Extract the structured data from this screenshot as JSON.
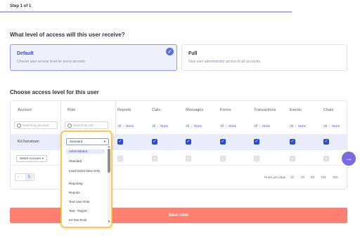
{
  "step": {
    "label": "Step 1 of 1"
  },
  "access": {
    "question": "What level of access will this user receive?",
    "options": [
      {
        "title": "Default",
        "description": "Choose user access level for every account.",
        "selected": true
      },
      {
        "title": "Full",
        "description": "Give user administrator access to all accounts.",
        "selected": false
      }
    ]
  },
  "level": {
    "question": "Choose access level for this user"
  },
  "table": {
    "headers": {
      "account": "Account",
      "role": "Role",
      "reports": "Reports",
      "calls": "Calls",
      "messages": "Messages",
      "forms": "Forms",
      "transactions": "Transactions",
      "events": "Events",
      "chats": "Chats"
    },
    "all_label": "All",
    "none_label": "None",
    "search_account_placeholder": "Search by account",
    "search_role_placeholder": "Search by role",
    "rows": [
      {
        "account": "Kit Damstown",
        "role": "Standard"
      },
      {
        "account": "Select Account",
        "role": ""
      }
    ],
    "pagination": {
      "current_page": "1",
      "rows_per_page_label": "Rows per page",
      "rows_per_page_options": [
        "10",
        "20",
        "50",
        "100",
        "250"
      ]
    }
  },
  "dropdown": {
    "selected": "Standard",
    "items": [
      "Administrator",
      "Standard",
      "Lead Detail View Only",
      "Reporting",
      "Reports",
      "Test User Role",
      "Test - Report",
      "Kit Test Role"
    ]
  },
  "buttons": {
    "save": "Save User",
    "next_icon": "arrow-right-icon"
  },
  "colors": {
    "accent": "#3b4fc7",
    "save": "#ff8071",
    "highlight": "#ffc64a",
    "fab": "#7b6be0"
  }
}
